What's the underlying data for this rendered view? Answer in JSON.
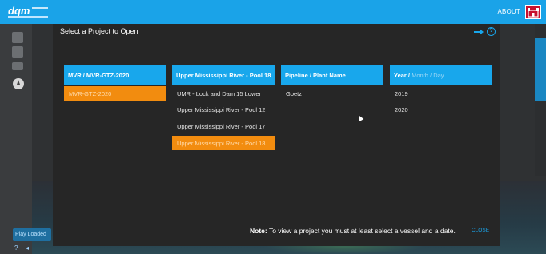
{
  "topbar": {
    "about_label": "ABOUT"
  },
  "sidebar": {
    "play_label": "Play Loaded"
  },
  "modal": {
    "title": "Select a Project to Open",
    "note_bold": "Note:",
    "note_text": " To view a project you must at least select a vessel and a date.",
    "close_label": "CLOSE",
    "columns": [
      {
        "header": "MVR / MVR-GTZ-2020",
        "items": [
          {
            "label": "MVR-GTZ-2020",
            "selected": true
          }
        ]
      },
      {
        "header": "Upper Mississippi River - Pool 18",
        "items": [
          {
            "label": "UMR - Lock and Dam 15 Lower",
            "selected": false
          },
          {
            "label": "Upper Mississippi River - Pool 12",
            "selected": false
          },
          {
            "label": "Upper Mississippi River - Pool 17",
            "selected": false
          },
          {
            "label": "Upper Mississippi River - Pool 18",
            "selected": true
          }
        ]
      },
      {
        "header": "Pipeline / Plant Name",
        "items": [
          {
            "label": "Goetz",
            "selected": false
          }
        ]
      },
      {
        "header_main": "Year /",
        "header_muted": " Month / Day",
        "items": [
          {
            "label": "2019",
            "selected": false
          },
          {
            "label": "2020",
            "selected": false
          }
        ]
      }
    ]
  },
  "colors": {
    "accent": "#18a7ec",
    "selected": "#f28c0f",
    "modal_bg": "#262626"
  },
  "icons": [
    "app-logo-icon",
    "corps-castle-icon",
    "arrow-right-icon",
    "help-icon",
    "compass-icon"
  ]
}
